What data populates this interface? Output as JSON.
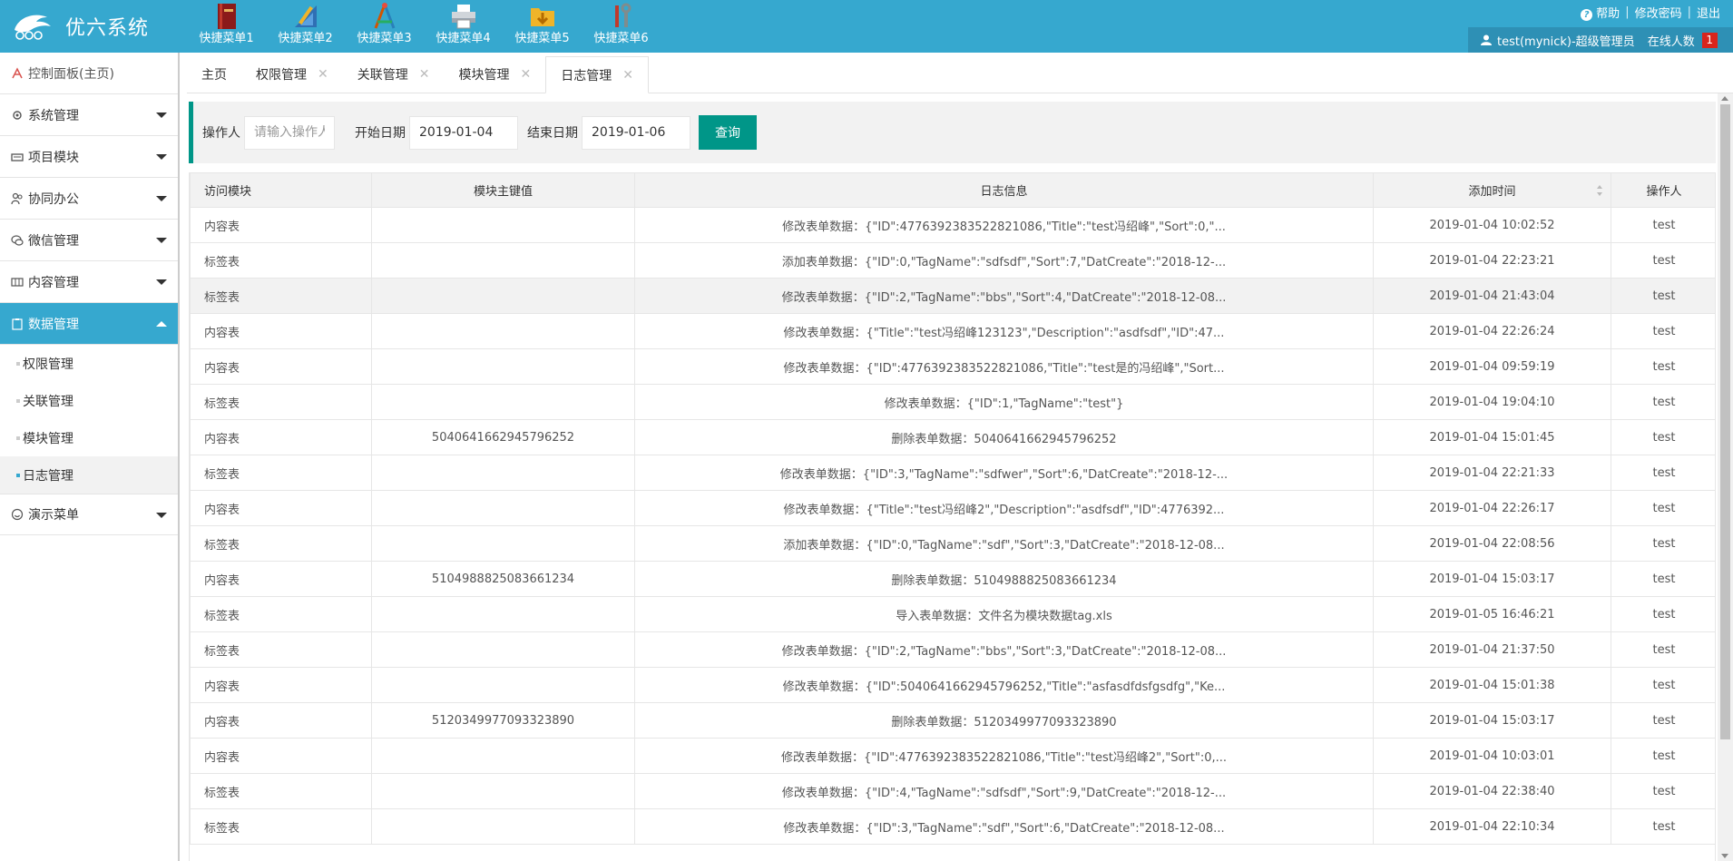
{
  "app": {
    "title": "优六系统",
    "logo_icon": "dolphin-logo-icon"
  },
  "quick_menu": [
    {
      "label": "快捷菜单1",
      "icon": "book-icon"
    },
    {
      "label": "快捷菜单2",
      "icon": "ruler-pencil-icon"
    },
    {
      "label": "快捷菜单3",
      "icon": "compass-icon"
    },
    {
      "label": "快捷菜单4",
      "icon": "printer-icon"
    },
    {
      "label": "快捷菜单5",
      "icon": "folder-download-icon"
    },
    {
      "label": "快捷菜单6",
      "icon": "tools-icon"
    }
  ],
  "top_links": {
    "help": "帮助",
    "change_password": "修改密码",
    "logout": "退出"
  },
  "user": {
    "name": "test(mynick)-超级管理员",
    "online_label": "在线人数",
    "online_count": "1"
  },
  "sidebar": {
    "home": "控制面板(主页)",
    "items": [
      {
        "label": "系统管理",
        "icon": "gear-icon"
      },
      {
        "label": "项目模块",
        "icon": "keyboard-icon"
      },
      {
        "label": "协同办公",
        "icon": "users-icon"
      },
      {
        "label": "微信管理",
        "icon": "wechat-icon"
      },
      {
        "label": "内容管理",
        "icon": "layout-icon"
      },
      {
        "label": "数据管理",
        "icon": "clipboard-icon"
      }
    ],
    "sub_items": [
      "权限管理",
      "关联管理",
      "模块管理",
      "日志管理"
    ],
    "last_item": {
      "label": "演示菜单",
      "icon": "smile-icon"
    }
  },
  "tabs": [
    {
      "label": "主页",
      "closable": false
    },
    {
      "label": "权限管理",
      "closable": true
    },
    {
      "label": "关联管理",
      "closable": true
    },
    {
      "label": "模块管理",
      "closable": true
    },
    {
      "label": "日志管理",
      "closable": true
    }
  ],
  "filter": {
    "operator_label": "操作人",
    "operator_placeholder": "请输入操作人",
    "start_label": "开始日期",
    "start_value": "2019-01-04",
    "end_label": "结束日期",
    "end_value": "2019-01-06",
    "query_label": "查询"
  },
  "table": {
    "columns": [
      "访问模块",
      "模块主键值",
      "日志信息",
      "添加时间",
      "操作人"
    ],
    "rows": [
      [
        "内容表",
        "",
        "修改表单数据：{\"ID\":4776392383522821086,\"Title\":\"test冯绍峰\",\"Sort\":0,\"...",
        "2019-01-04 10:02:52",
        "test"
      ],
      [
        "标签表",
        "",
        "添加表单数据：{\"ID\":0,\"TagName\":\"sdfsdf\",\"Sort\":7,\"DatCreate\":\"2018-12-...",
        "2019-01-04 22:23:21",
        "test"
      ],
      [
        "标签表",
        "",
        "修改表单数据：{\"ID\":2,\"TagName\":\"bbs\",\"Sort\":4,\"DatCreate\":\"2018-12-08...",
        "2019-01-04 21:43:04",
        "test"
      ],
      [
        "内容表",
        "",
        "修改表单数据：{\"Title\":\"test冯绍峰123123\",\"Description\":\"asdfsdf\",\"ID\":47...",
        "2019-01-04 22:26:24",
        "test"
      ],
      [
        "内容表",
        "",
        "修改表单数据：{\"ID\":4776392383522821086,\"Title\":\"test是的冯绍峰\",\"Sort...",
        "2019-01-04 09:59:19",
        "test"
      ],
      [
        "标签表",
        "",
        "修改表单数据：{\"ID\":1,\"TagName\":\"test\"}",
        "2019-01-04 19:04:10",
        "test"
      ],
      [
        "内容表",
        "5040641662945796252",
        "删除表单数据：5040641662945796252",
        "2019-01-04 15:01:45",
        "test"
      ],
      [
        "标签表",
        "",
        "修改表单数据：{\"ID\":3,\"TagName\":\"sdfwer\",\"Sort\":6,\"DatCreate\":\"2018-12-...",
        "2019-01-04 22:21:33",
        "test"
      ],
      [
        "内容表",
        "",
        "修改表单数据：{\"Title\":\"test冯绍峰2\",\"Description\":\"asdfsdf\",\"ID\":4776392...",
        "2019-01-04 22:26:17",
        "test"
      ],
      [
        "标签表",
        "",
        "添加表单数据：{\"ID\":0,\"TagName\":\"sdf\",\"Sort\":3,\"DatCreate\":\"2018-12-08...",
        "2019-01-04 22:08:56",
        "test"
      ],
      [
        "内容表",
        "5104988825083661234",
        "删除表单数据：5104988825083661234",
        "2019-01-04 15:03:17",
        "test"
      ],
      [
        "标签表",
        "",
        "导入表单数据：文件名为模块数据tag.xls",
        "2019-01-05 16:46:21",
        "test"
      ],
      [
        "标签表",
        "",
        "修改表单数据：{\"ID\":2,\"TagName\":\"bbs\",\"Sort\":3,\"DatCreate\":\"2018-12-08...",
        "2019-01-04 21:37:50",
        "test"
      ],
      [
        "内容表",
        "",
        "修改表单数据：{\"ID\":5040641662945796252,\"Title\":\"asfasdfdsfgsdfg\",\"Ke...",
        "2019-01-04 15:01:38",
        "test"
      ],
      [
        "内容表",
        "5120349977093323890",
        "删除表单数据：5120349977093323890",
        "2019-01-04 15:03:17",
        "test"
      ],
      [
        "内容表",
        "",
        "修改表单数据：{\"ID\":4776392383522821086,\"Title\":\"test冯绍峰2\",\"Sort\":0,...",
        "2019-01-04 10:03:01",
        "test"
      ],
      [
        "标签表",
        "",
        "修改表单数据：{\"ID\":4,\"TagName\":\"sdfsdf\",\"Sort\":9,\"DatCreate\":\"2018-12-...",
        "2019-01-04 22:38:40",
        "test"
      ],
      [
        "标签表",
        "",
        "修改表单数据：{\"ID\":3,\"TagName\":\"sdf\",\"Sort\":6,\"DatCreate\":\"2018-12-08...",
        "2019-01-04 22:10:34",
        "test"
      ]
    ]
  },
  "colors": {
    "header": "#36a8cf",
    "active_nav": "#36a8cf",
    "accent": "#009688",
    "badge": "#d9241c"
  }
}
